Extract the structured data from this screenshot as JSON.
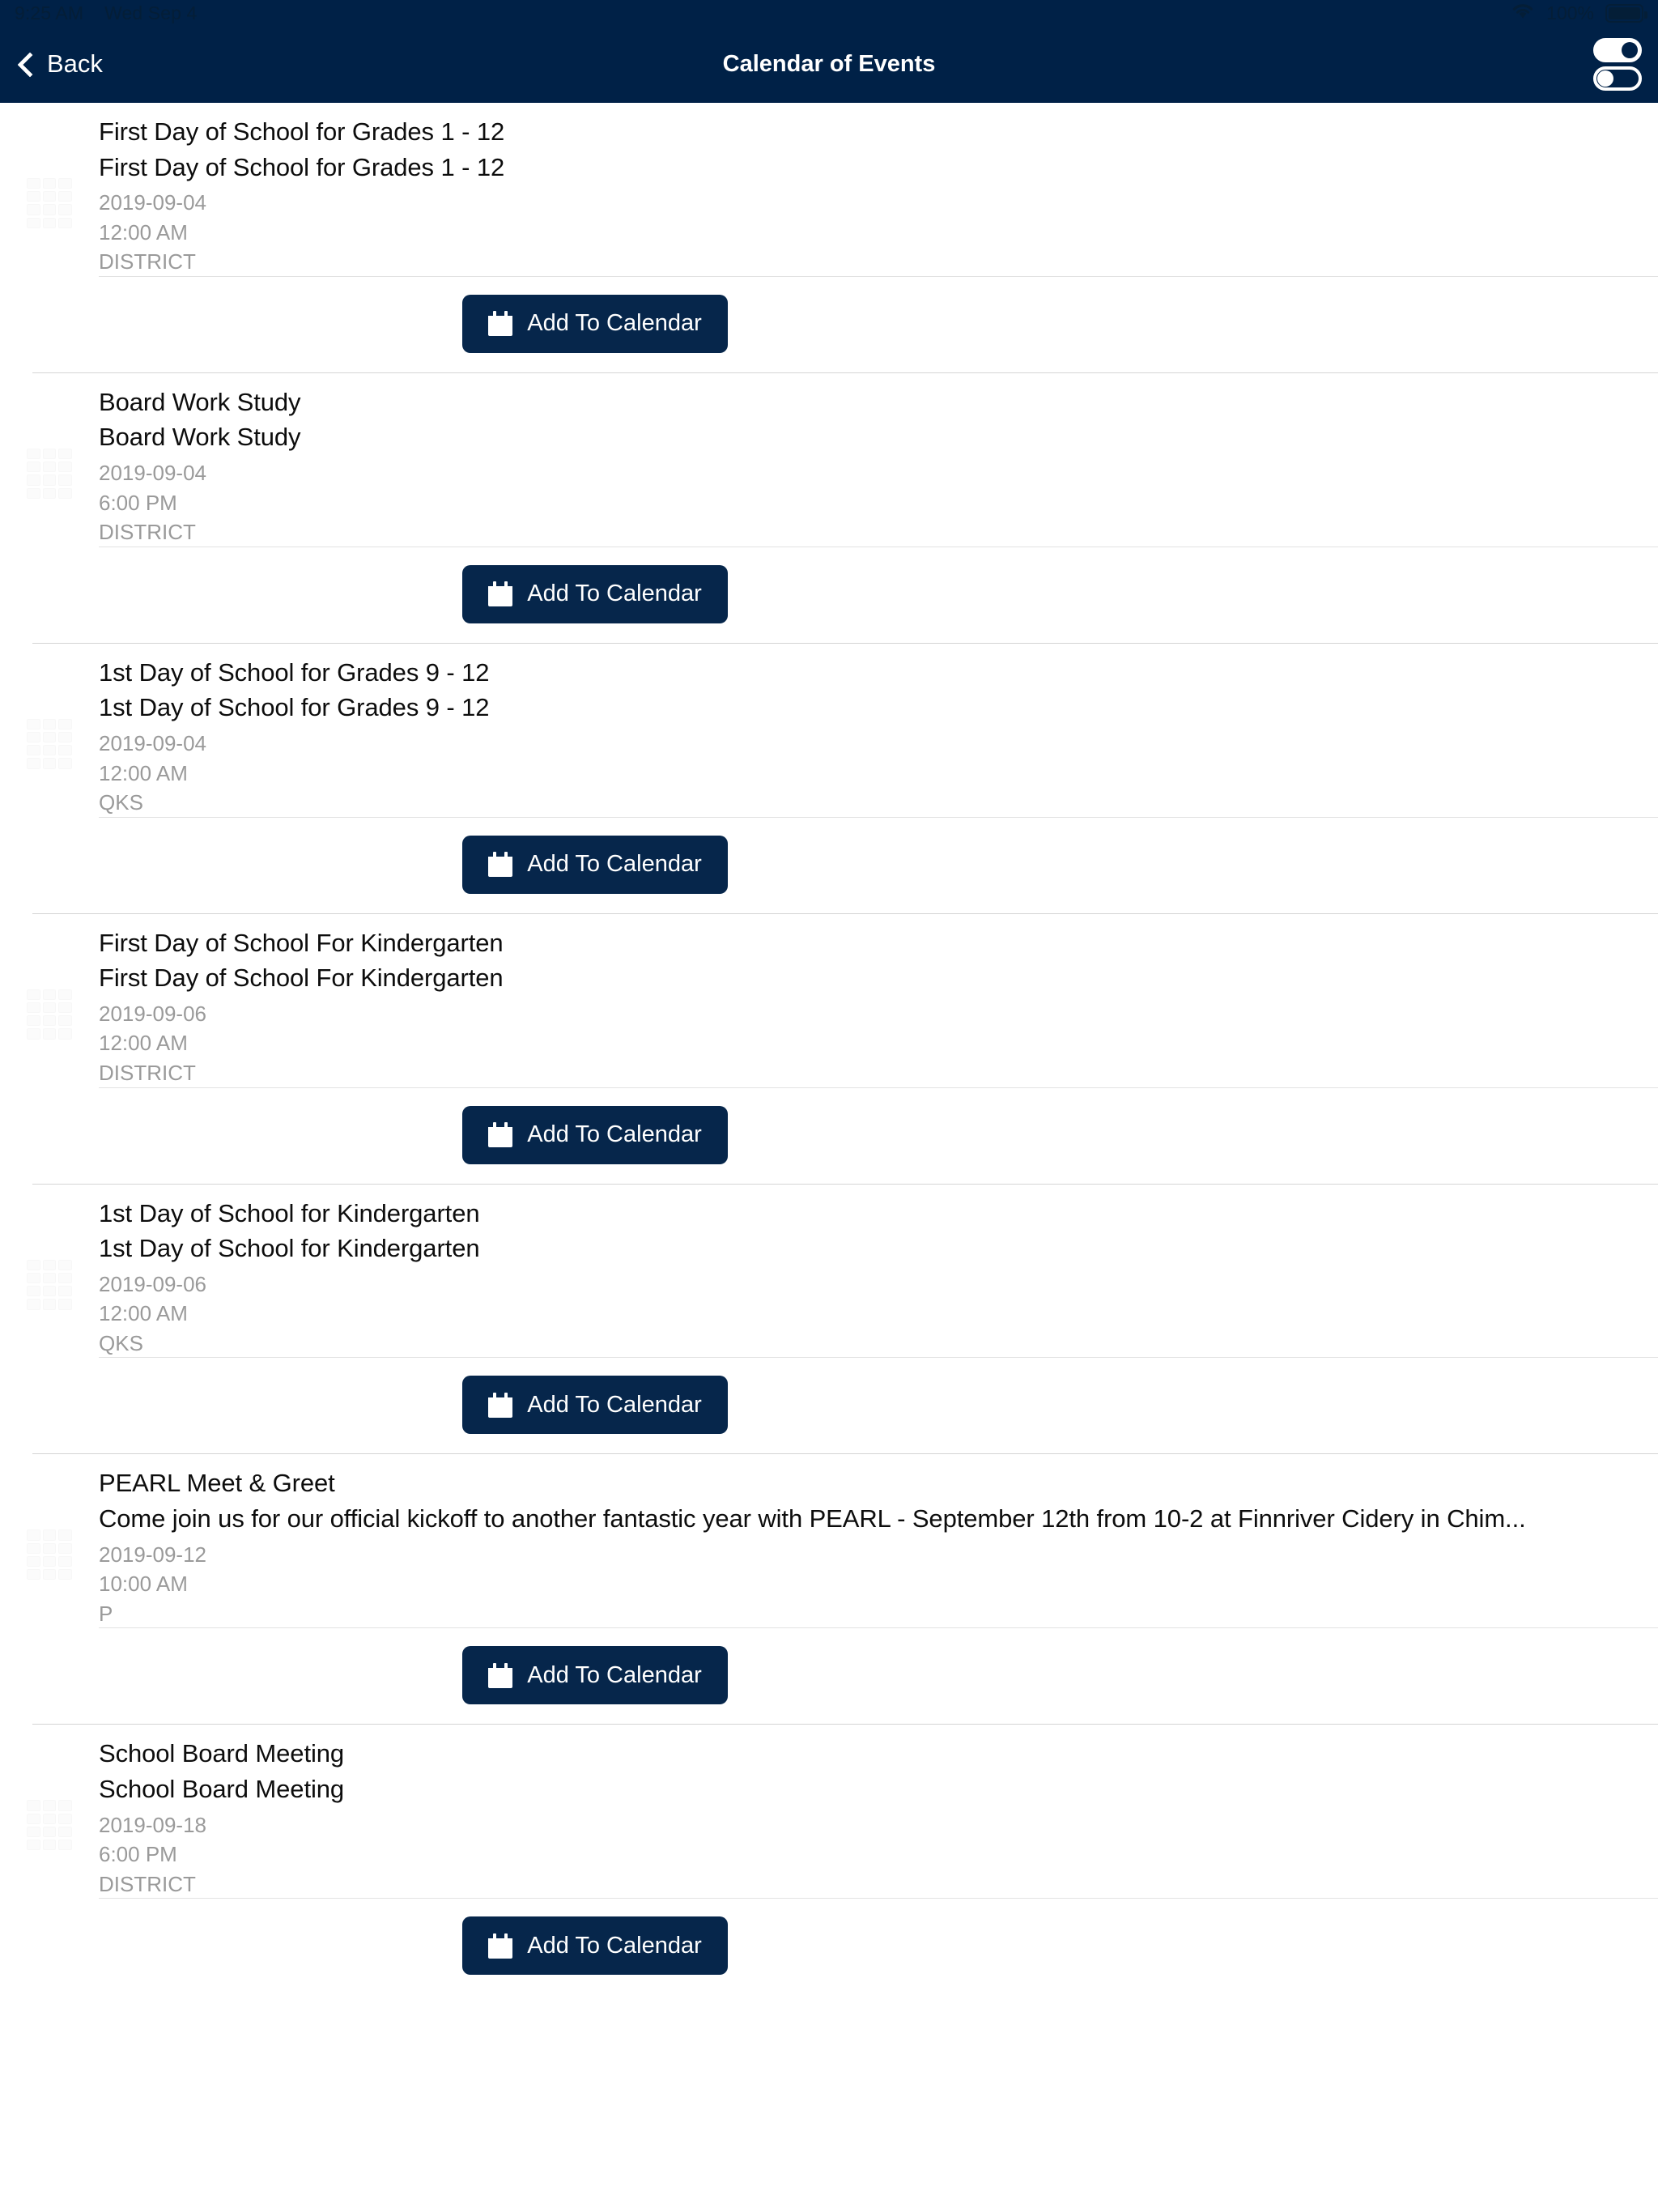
{
  "status_bar": {
    "time": "9:25 AM",
    "date": "Wed Sep 4",
    "battery_percent": "100%",
    "wifi_icon": "wifi-icon",
    "battery_icon": "battery-full-icon"
  },
  "nav": {
    "back_label": "Back",
    "back_icon": "chevron-left-icon",
    "title": "Calendar of Events",
    "toggle_icon": "sliders-toggle-icon",
    "background_color": "#002147"
  },
  "theme": {
    "nav_background": "#002147",
    "button_background": "#06264b",
    "title_color": "#0d0d0d",
    "meta_color": "#9a9a9a",
    "divider_color": "#d4d4d4"
  },
  "button": {
    "add_to_calendar_label": "Add To Calendar",
    "calendar_icon": "calendar-icon"
  },
  "events": [
    {
      "title": "First Day of School for Grades 1 - 12",
      "description": "First Day of School for Grades 1 - 12",
      "date": "2019-09-04",
      "time": "12:00 AM",
      "location": "DISTRICT",
      "thumbnail_icon": "calendar-placeholder-icon"
    },
    {
      "title": "Board Work Study",
      "description": "Board Work Study",
      "date": "2019-09-04",
      "time": "6:00 PM",
      "location": "DISTRICT",
      "thumbnail_icon": "calendar-placeholder-icon"
    },
    {
      "title": "1st Day of School for Grades 9 - 12",
      "description": "1st Day of School for Grades 9 - 12",
      "date": "2019-09-04",
      "time": "12:00 AM",
      "location": "QKS",
      "thumbnail_icon": "calendar-placeholder-icon"
    },
    {
      "title": "First Day of School For Kindergarten",
      "description": "First Day of School For Kindergarten",
      "date": "2019-09-06",
      "time": "12:00 AM",
      "location": "DISTRICT",
      "thumbnail_icon": "calendar-placeholder-icon"
    },
    {
      "title": "1st Day of School for Kindergarten",
      "description": "1st Day of School for Kindergarten",
      "date": "2019-09-06",
      "time": "12:00 AM",
      "location": "QKS",
      "thumbnail_icon": "calendar-placeholder-icon"
    },
    {
      "title": "PEARL Meet & Greet",
      "description": "Come join us for our official kickoff to another fantastic year with PEARL - September 12th from 10-2 at Finnriver Cidery in Chim...",
      "date": "2019-09-12",
      "time": "10:00 AM",
      "location": "P",
      "thumbnail_icon": "calendar-placeholder-icon"
    },
    {
      "title": "School Board Meeting",
      "description": "School Board Meeting",
      "date": "2019-09-18",
      "time": "6:00 PM",
      "location": "DISTRICT",
      "thumbnail_icon": "calendar-placeholder-icon"
    }
  ]
}
